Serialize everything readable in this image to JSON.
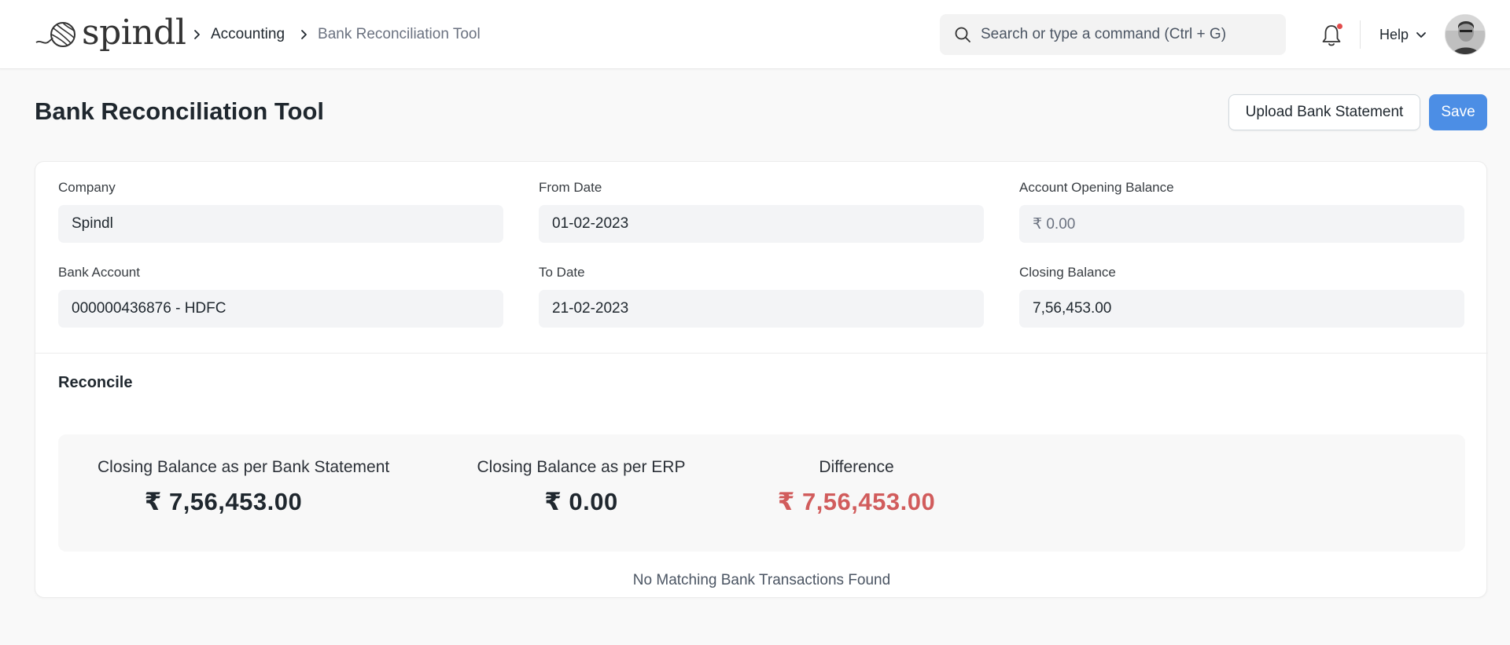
{
  "brand": {
    "name": "spindl"
  },
  "breadcrumb": {
    "parent": "Accounting",
    "current": "Bank Reconciliation Tool"
  },
  "search": {
    "placeholder": "Search or type a command (Ctrl + G)"
  },
  "nav": {
    "help_label": "Help"
  },
  "page": {
    "title": "Bank Reconciliation Tool",
    "upload_label": "Upload Bank Statement",
    "save_label": "Save"
  },
  "fields": {
    "company": {
      "label": "Company",
      "value": "Spindl"
    },
    "from_date": {
      "label": "From Date",
      "value": "01-02-2023"
    },
    "opening_balance": {
      "label": "Account Opening Balance",
      "value": "₹ 0.00"
    },
    "bank_account": {
      "label": "Bank Account",
      "value": "000000436876 - HDFC"
    },
    "to_date": {
      "label": "To Date",
      "value": "21-02-2023"
    },
    "closing_balance": {
      "label": "Closing Balance",
      "value": "7,56,453.00"
    }
  },
  "reconcile": {
    "title": "Reconcile",
    "bank_statement": {
      "label": "Closing Balance as per Bank Statement",
      "value": "₹ 7,56,453.00"
    },
    "erp": {
      "label": "Closing Balance as per ERP",
      "value": "₹ 0.00"
    },
    "difference": {
      "label": "Difference",
      "value": "₹ 7,56,453.00"
    },
    "empty_message": "No Matching Bank Transactions Found"
  },
  "colors": {
    "primary": "#4c8ee5",
    "difference": "#d15c5c",
    "notification_dot": "#e24c4c"
  },
  "icons": {
    "logo": "yarn-ball-icon",
    "separator": "chevron-right-icon",
    "search": "search-icon",
    "notifications": "bell-icon",
    "help_menu": "chevron-down-icon"
  }
}
